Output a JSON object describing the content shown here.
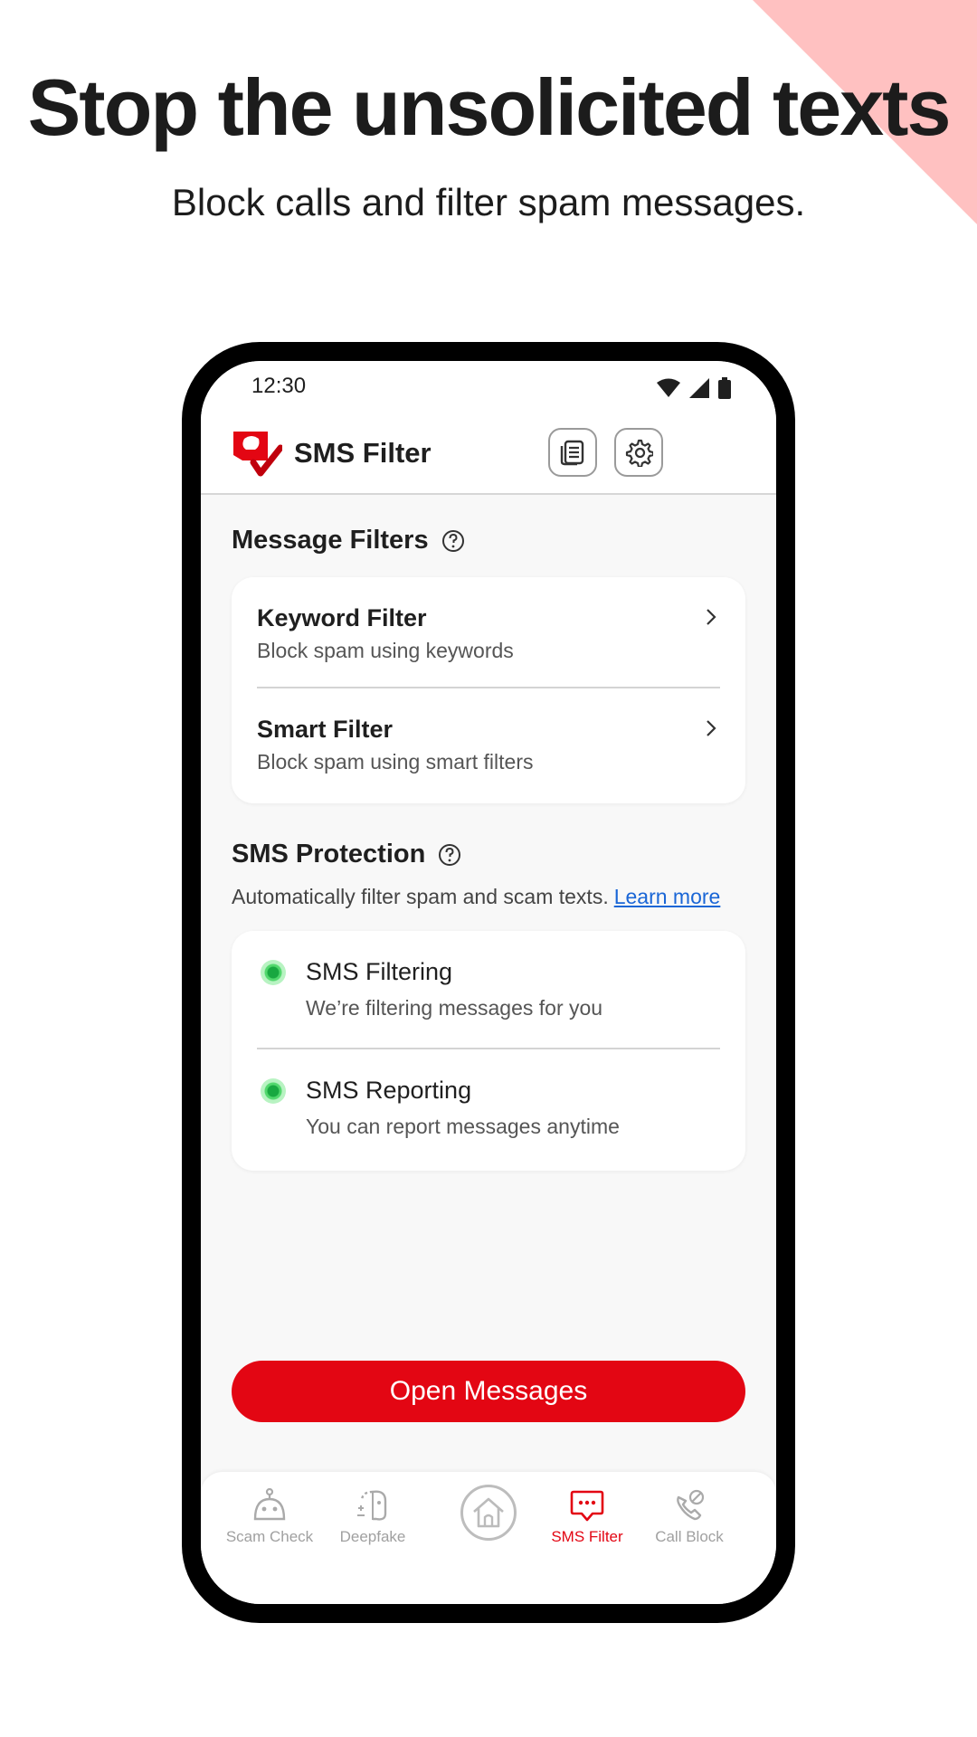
{
  "promo": {
    "headline": "Stop the unsolicited texts",
    "subheadline": "Block calls and filter spam messages.",
    "accent_color": "#ffc1c1"
  },
  "status_bar": {
    "time": "12:30",
    "icons": [
      "wifi-icon",
      "signal-icon",
      "battery-icon"
    ]
  },
  "app_bar": {
    "title": "SMS Filter",
    "logo": "app-logo",
    "actions": [
      "history-icon",
      "gear-icon"
    ]
  },
  "message_filters": {
    "title": "Message Filters",
    "items": [
      {
        "title": "Keyword Filter",
        "subtitle": "Block spam using keywords"
      },
      {
        "title": "Smart Filter",
        "subtitle": "Block spam using smart filters"
      }
    ]
  },
  "sms_protection": {
    "title": "SMS Protection",
    "description": "Automatically filter spam and scam texts.",
    "link": "Learn more",
    "items": [
      {
        "title": "SMS Filtering",
        "subtitle": "We’re filtering messages for you",
        "status": "active"
      },
      {
        "title": "SMS Reporting",
        "subtitle": "You can report messages anytime",
        "status": "active"
      }
    ]
  },
  "cta": {
    "label": "Open Messages",
    "color": "#e30613"
  },
  "bottom_nav": {
    "items": [
      {
        "label": "Scam Check",
        "icon": "robot-icon"
      },
      {
        "label": "Deepfake",
        "icon": "deepfake-icon"
      },
      {
        "label": "",
        "icon": "home-icon"
      },
      {
        "label": "SMS Filter",
        "icon": "message-icon",
        "active": true
      },
      {
        "label": "Call Block",
        "icon": "phone-block-icon"
      }
    ]
  }
}
